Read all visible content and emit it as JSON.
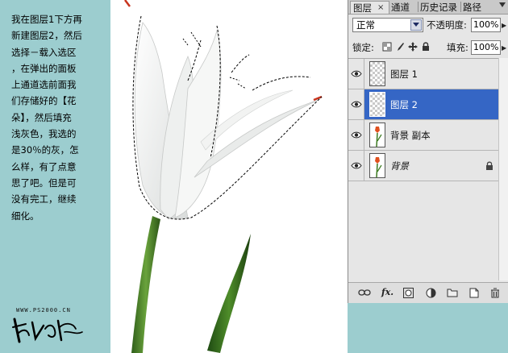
{
  "instruction_lines": [
    "我在图层1下方再",
    "新建图层2，然后",
    "选择－载入选区",
    "，在弹出的面板",
    "上通道选前面我",
    "们存储好的【花",
    "朵】，然后填充",
    "浅灰色，我选的",
    "是30％的灰，怎",
    "么样，有了点意",
    "思了吧。但是可",
    "没有完工，继续",
    "细化。"
  ],
  "site_url": "WWW.PS2000.CN",
  "tabs": {
    "layers": "图层",
    "close_glyph": "×",
    "channels": "通道",
    "history": "历史记录",
    "paths": "路径"
  },
  "blend_mode": "正常",
  "opacity": {
    "label": "不透明度:",
    "value": "100%"
  },
  "lock": {
    "label": "锁定:"
  },
  "fill": {
    "label": "填充:",
    "value": "100%"
  },
  "layers": [
    {
      "name": "图层 1",
      "visible": true,
      "selected": false,
      "locked": false
    },
    {
      "name": "图层 2",
      "visible": true,
      "selected": true,
      "locked": false
    },
    {
      "name": "背景 副本",
      "visible": true,
      "selected": false,
      "locked": false
    },
    {
      "name": "背景",
      "visible": true,
      "selected": false,
      "locked": true
    }
  ],
  "toolbar": {
    "fx": "fx."
  },
  "colors": {
    "teal": "#9ccdcf",
    "selection": "#3566c5",
    "panel": "#e6e6e6"
  }
}
